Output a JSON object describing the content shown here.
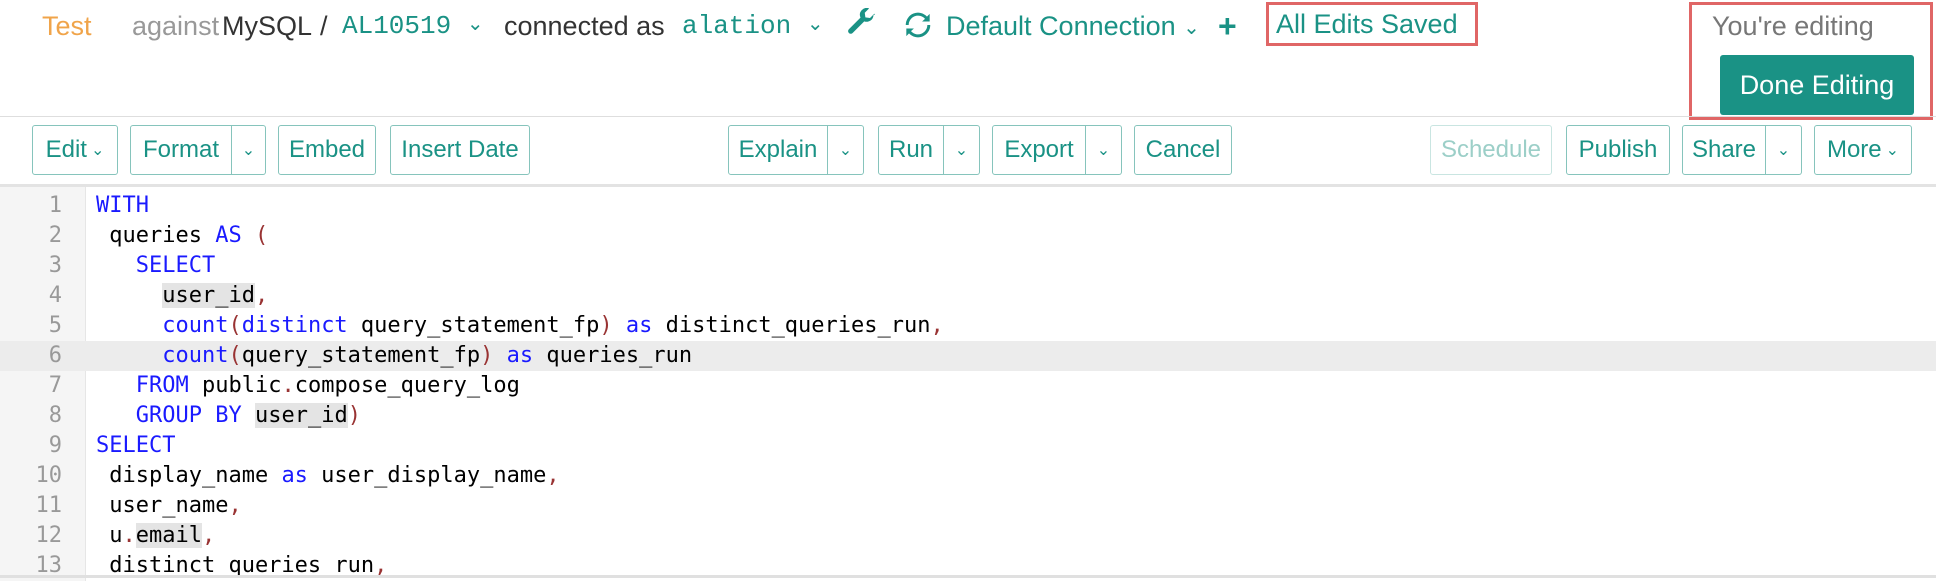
{
  "header": {
    "query_title": "Test",
    "against_label": "against",
    "db_type": "MySQL",
    "separator": "/",
    "datasource": "AL10519",
    "connected_as_label": "connected as",
    "username": "alation",
    "connection_name": "Default Connection",
    "save_status": "All Edits Saved",
    "editing_status": "You're editing",
    "done_editing_label": "Done Editing",
    "icons": {
      "wrench": "wrench-icon",
      "refresh": "refresh-icon",
      "add": "plus-icon"
    }
  },
  "toolbar": {
    "edit": "Edit",
    "format": "Format",
    "embed": "Embed",
    "insert_date": "Insert Date",
    "explain": "Explain",
    "run": "Run",
    "export": "Export",
    "cancel": "Cancel",
    "schedule": "Schedule",
    "publish": "Publish",
    "share": "Share",
    "more": "More"
  },
  "editor": {
    "active_line": 6,
    "lines": [
      {
        "n": "1",
        "code": "WITH"
      },
      {
        "n": "2",
        "code": " queries AS ("
      },
      {
        "n": "3",
        "code": "   SELECT"
      },
      {
        "n": "4",
        "code": "     user_id,"
      },
      {
        "n": "5",
        "code": "     count(distinct query_statement_fp) as distinct_queries_run,"
      },
      {
        "n": "6",
        "code": "     count(query_statement_fp) as queries_run"
      },
      {
        "n": "7",
        "code": "   FROM public.compose_query_log"
      },
      {
        "n": "8",
        "code": "   GROUP BY user_id)"
      },
      {
        "n": "9",
        "code": "SELECT"
      },
      {
        "n": "10",
        "code": " display_name as user_display_name,"
      },
      {
        "n": "11",
        "code": " user_name,"
      },
      {
        "n": "12",
        "code": " u.email,"
      },
      {
        "n": "13",
        "code": " distinct_queries_run,"
      }
    ]
  },
  "colors": {
    "accent": "#1a9285",
    "title": "#f0a44a",
    "highlight_border": "#e06666",
    "keyword": "#1a1aff"
  }
}
